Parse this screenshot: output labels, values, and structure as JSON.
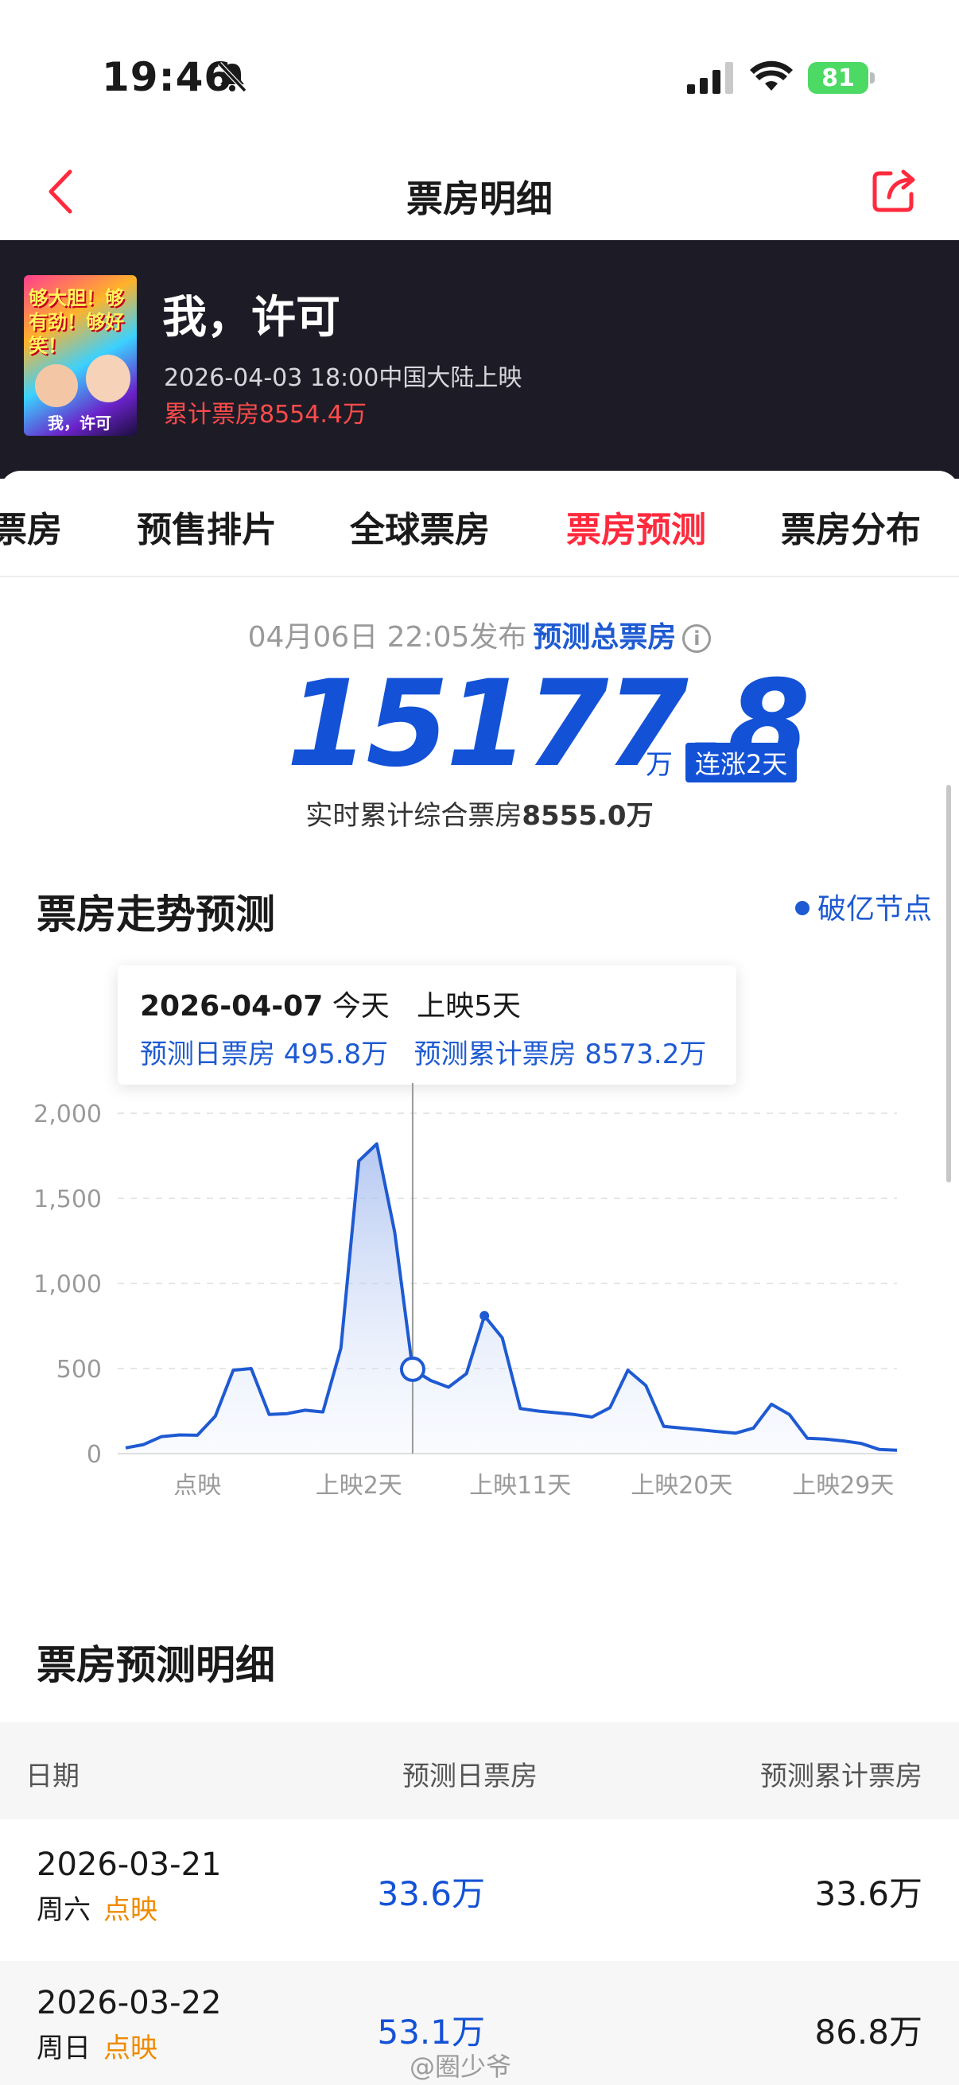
{
  "status_bar": {
    "time": "19:46",
    "battery": "81"
  },
  "nav": {
    "title": "票房明细"
  },
  "movie": {
    "title": "我，许可",
    "release": "2026-04-03 18:00中国大陆上映",
    "cumulative": "累计票房8554.4万",
    "poster_text": "够大胆！够有劲！够好笑！",
    "poster_sub": "我，许可"
  },
  "tabs": [
    {
      "label": "票房"
    },
    {
      "label": "预售排片"
    },
    {
      "label": "全球票房"
    },
    {
      "label": "票房预测",
      "active": true
    },
    {
      "label": "票房分布"
    }
  ],
  "forecast": {
    "published": "04月06日 22:05发布",
    "link": "预测总票房",
    "value": "15177.8",
    "unit": "万",
    "badge": "连涨2天",
    "realtime_label": "实时累计综合票房",
    "realtime_value": "8555.0万"
  },
  "trend": {
    "title": "票房走势预测",
    "legend": "破亿节点"
  },
  "tooltip": {
    "date": "2026-04-07",
    "today": "今天",
    "days": "上映5天",
    "daily": "预测日票房 495.8万",
    "cumulative": "预测累计票房 8573.2万"
  },
  "chart_data": {
    "type": "area",
    "ylim": [
      0,
      2000
    ],
    "yticks": [
      "2,000",
      "1,500",
      "1,000",
      "500",
      "0"
    ],
    "xtick_labels": [
      "点映",
      "上映2天",
      "上映11天",
      "上映20天",
      "上映29天"
    ],
    "series": [
      {
        "values": [
          33.6,
          53.1,
          100,
          110,
          108,
          220,
          490,
          500,
          230,
          235,
          255,
          245,
          620,
          1720,
          1820,
          1300,
          495.8,
          430,
          390,
          470,
          810,
          680,
          265,
          250,
          240,
          230,
          215,
          270,
          490,
          400,
          160,
          150,
          140,
          130,
          120,
          150,
          290,
          230,
          90,
          85,
          75,
          60,
          25,
          20
        ]
      }
    ],
    "highlight_index": 16,
    "marker_index": 20,
    "color": "#1e5ad2"
  },
  "detail": {
    "title": "票房预测明细",
    "headers": [
      "日期",
      "预测日票房",
      "预测累计票房"
    ],
    "rows": [
      {
        "date": "2026-03-21",
        "week": "周六",
        "tag": "点映",
        "daily": "33.6万",
        "cum": "33.6万"
      },
      {
        "date": "2026-03-22",
        "week": "周日",
        "tag": "点映",
        "daily": "53.1万",
        "cum": "86.8万"
      }
    ]
  },
  "watermark": "@圈少爷"
}
